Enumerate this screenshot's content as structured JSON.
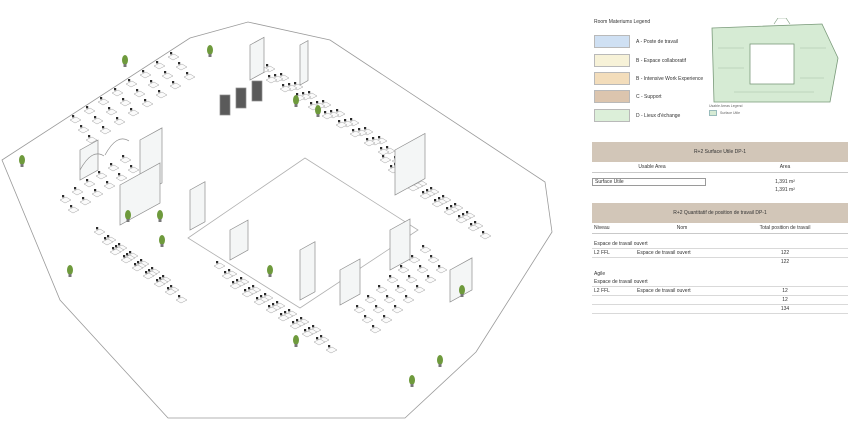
{
  "legend": {
    "title": "Room Materiums Legend",
    "items": [
      {
        "label": "A - Poste de travail",
        "color": "#cfe0f3"
      },
      {
        "label": "B - Espace collaboratif",
        "color": "#f7f2d8"
      },
      {
        "label": "B - Intensive Work Experience",
        "color": "#f3ddbb"
      },
      {
        "label": "C - Support",
        "color": "#dcc5ae"
      },
      {
        "label": "D - Lieux d'échange",
        "color": "#dcefd9"
      }
    ]
  },
  "keyplan": {
    "caption": "Usable Areas Legend",
    "legend_label": "Surface Utile",
    "fill_color": "#d6ebd4"
  },
  "surface_table": {
    "title": "R+2 Surface Utile DP-1",
    "col_usable": "Usable Area",
    "col_area": "Area",
    "row_label": "Surface Utile",
    "row_value": "1,391 m²",
    "total_value": "1,391 m²"
  },
  "workstation_table": {
    "title": "R+2 Quantitatif de position de travail DP-1",
    "col_niveau": "Niveau",
    "col_nom": "Nom",
    "col_total": "Total position de travail",
    "group1_label": "Espace de travail ouvert",
    "group1_level": "L2 FFL",
    "group1_name": "Espace de travail ouvert",
    "group1_value": "122",
    "group1_subtotal": "122",
    "group2_label": "Agile",
    "group2_sub": "Espace de travail ouvert",
    "group2_level": "L2 FFL",
    "group2_name": "Espace de travail ouvert",
    "group2_value": "12",
    "group2_subtotal": "12",
    "grand_total": "134"
  }
}
